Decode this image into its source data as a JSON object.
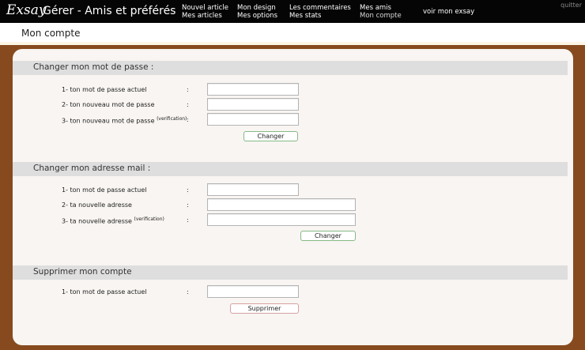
{
  "header": {
    "logo": "Exsay",
    "page_heading": "Gérer - Amis et préférés",
    "nav": [
      {
        "line1": "Nouvel article",
        "line2": "Mes articles"
      },
      {
        "line1": "Mon design",
        "line2": "Mes options"
      },
      {
        "line1": "Les commentaires",
        "line2": "Mes stats"
      },
      {
        "line1": "Mes amis",
        "line2": "Mon compte"
      }
    ],
    "view_link": "voir mon exsay",
    "quit_link": "quitter"
  },
  "subheader": {
    "title": "Mon compte"
  },
  "sections": {
    "password": {
      "title": "Changer mon mot de passe :",
      "fields": [
        {
          "label": "1- ton mot de passe actuel",
          "sup": ""
        },
        {
          "label": "2- ton nouveau mot de passe",
          "sup": ""
        },
        {
          "label": "3- ton nouveau mot de passe",
          "sup": "(verification)"
        }
      ],
      "button": "Changer"
    },
    "email": {
      "title": "Changer mon adresse mail :",
      "fields": [
        {
          "label": "1- ton mot de passe actuel",
          "sup": ""
        },
        {
          "label": "2- ta nouvelle adresse",
          "sup": ""
        },
        {
          "label": "3- ta nouvelle adresse",
          "sup": "(verification)"
        }
      ],
      "button": "Changer"
    },
    "delete": {
      "title": "Supprimer mon compte",
      "fields": [
        {
          "label": "1- ton mot de passe actuel",
          "sup": ""
        }
      ],
      "button": "Supprimer"
    }
  },
  "colon": ":",
  "colors": {
    "background": "#874a1e",
    "topbar": "#050505",
    "panel": "#f8f5f2",
    "section_bar": "#dedede"
  }
}
